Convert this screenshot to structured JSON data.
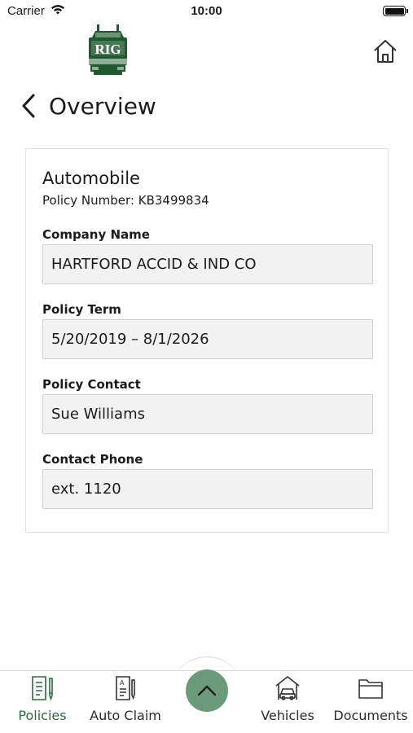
{
  "status_bar": {
    "carrier": "Carrier",
    "time": "10:00"
  },
  "header": {
    "logo_text": "RIG",
    "home_icon": "home-icon"
  },
  "nav": {
    "title": "Overview",
    "back_icon": "chevron-left-icon"
  },
  "policy": {
    "type": "Automobile",
    "number_line": "Policy Number: KB3499834",
    "fields": [
      {
        "label": "Company Name",
        "value": "HARTFORD ACCID & IND CO"
      },
      {
        "label": "Policy Term",
        "value": "5/20/2019 – 8/1/2026"
      },
      {
        "label": "Policy Contact",
        "value": "Sue Williams"
      },
      {
        "label": "Contact Phone",
        "value": "ext. 1120"
      }
    ]
  },
  "tabs": [
    {
      "label": "Policies",
      "icon": "policy-document-icon",
      "active": true
    },
    {
      "label": "Auto Claim",
      "icon": "claim-form-icon",
      "active": false
    },
    {
      "label": "Vehicles",
      "icon": "car-garage-icon",
      "active": false
    },
    {
      "label": "Documents",
      "icon": "folder-icon",
      "active": false
    }
  ],
  "fab_icon": "chevron-up-icon",
  "colors": {
    "brand_green": "#1f5a2f",
    "active_tab": "#2f6b3c",
    "fab": "#6b9a7a"
  }
}
